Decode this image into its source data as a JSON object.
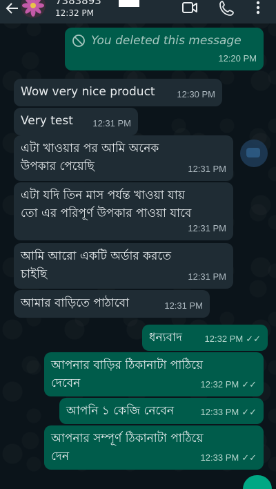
{
  "header": {
    "contact_name": "7383893",
    "last_seen": "12:32 PM",
    "icons": [
      "back-arrow-icon",
      "video-call-icon",
      "voice-call-icon",
      "more-options-icon"
    ]
  },
  "messages": [
    {
      "direction": "out",
      "deleted": true,
      "text": "You deleted this message",
      "time": "12:20 PM"
    },
    {
      "direction": "in",
      "text": "Wow very nice product",
      "time": "12:30 PM"
    },
    {
      "direction": "in",
      "text": "Very test",
      "time": "12:31 PM"
    },
    {
      "direction": "in",
      "lines": [
        "এটা খাওয়ার পর আমি অনেক",
        "উপকার পেয়েছি"
      ],
      "time": "12:31 PM"
    },
    {
      "direction": "in",
      "lines": [
        "এটা যদি তিন মাস পর্যন্ত খাওয়া যায়",
        "তো এর পরিপূর্ণ উপকার পাওয়া যাবে"
      ],
      "time": "12:31 PM"
    },
    {
      "direction": "in",
      "lines": [
        "আমি আরো একটি অর্ডার করতে",
        "চাইছি"
      ],
      "time": "12:31 PM"
    },
    {
      "direction": "in",
      "text": "আমার বাড়িতে পাঠাবো",
      "time": "12:31 PM"
    },
    {
      "direction": "out",
      "text": "ধন্যবাদ",
      "time": "12:32 PM",
      "read": true
    },
    {
      "direction": "out",
      "lines": [
        "আপনার বাড়ির ঠিকানাটা পাঠিয়ে",
        "দেবেন"
      ],
      "time": "12:32 PM",
      "read": true
    },
    {
      "direction": "out",
      "text": "আপনি ১ কেজি নেবেন",
      "time": "12:33 PM",
      "read": true
    },
    {
      "direction": "out",
      "lines": [
        "আপনার সম্পূর্ণ ঠিকানাটা পাঠিয়ে",
        "দেন"
      ],
      "time": "12:33 PM",
      "read": true
    }
  ],
  "colors": {
    "background": "#0b141a",
    "incoming_bubble": "#1f2c34",
    "outgoing_bubble": "#005c4b",
    "accent": "#00a884"
  }
}
